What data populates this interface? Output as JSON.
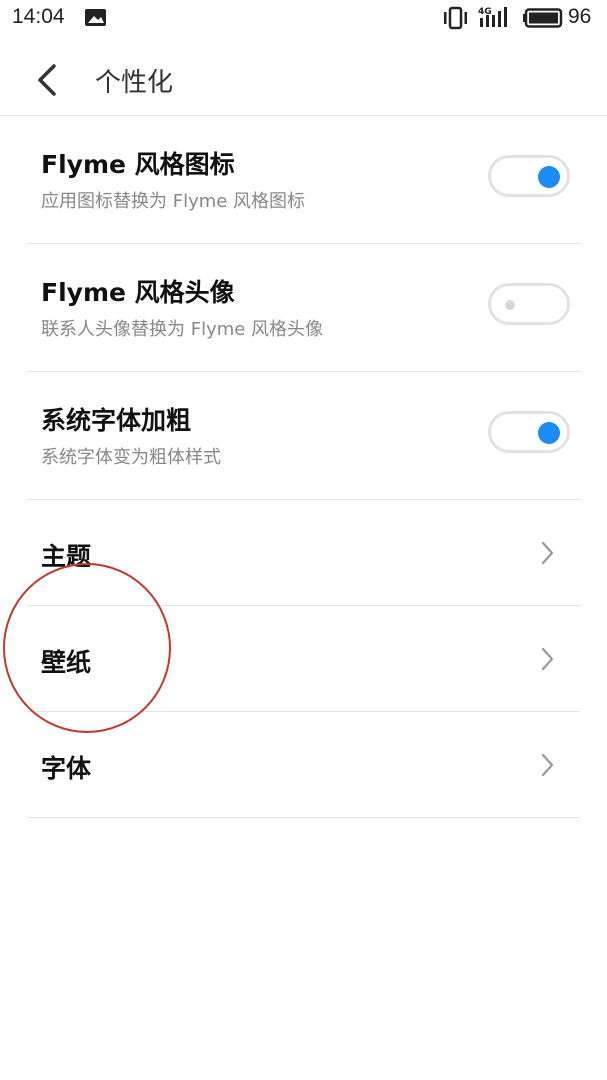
{
  "status_bar": {
    "time": "14:04",
    "network": "4G",
    "battery": "96"
  },
  "header": {
    "title": "个性化"
  },
  "settings": [
    {
      "title": "Flyme 风格图标",
      "subtitle": "应用图标替换为 Flyme 风格图标",
      "enabled": true
    },
    {
      "title": "Flyme 风格头像",
      "subtitle": "联系人头像替换为 Flyme 风格头像",
      "enabled": false
    },
    {
      "title": "系统字体加粗",
      "subtitle": "系统字体变为粗体样式",
      "enabled": true
    }
  ],
  "links": [
    {
      "title": "主题"
    },
    {
      "title": "壁纸"
    },
    {
      "title": "字体"
    }
  ],
  "colors": {
    "accent": "#1b8cf2",
    "annotation": "#c0392b"
  }
}
